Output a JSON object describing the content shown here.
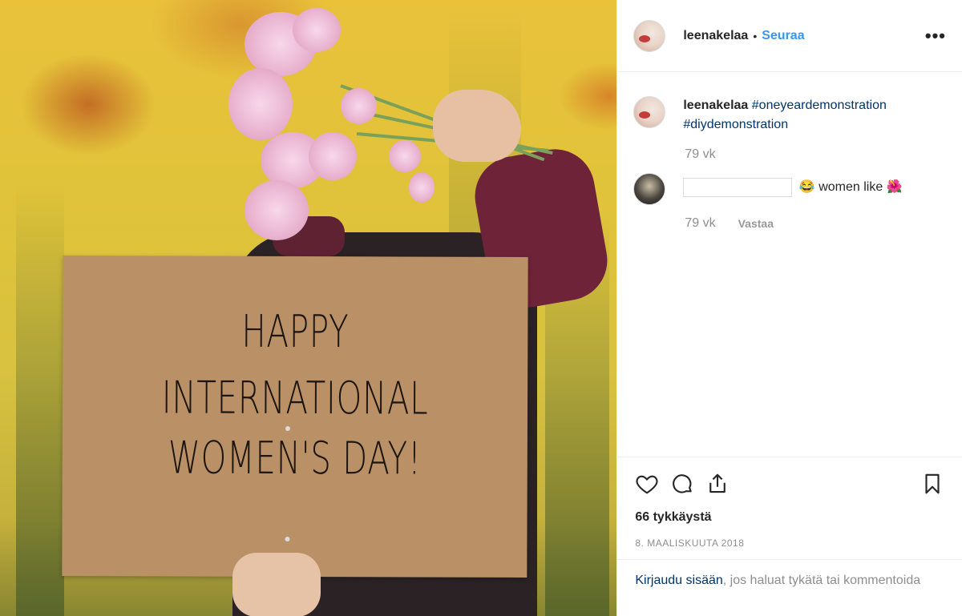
{
  "post": {
    "username": "leenakelaa",
    "separator": "•",
    "follow_label": "Seuraa",
    "more_label": "•••"
  },
  "photo": {
    "sign_lines": [
      "HAPPY",
      "INTERNATIONAL",
      "WOMEN'S DAY!"
    ]
  },
  "caption": {
    "username": "leenakelaa",
    "hashtag1": "#oneyeardemonstration",
    "hashtag2": "#diydemonstration",
    "time": "79 vk"
  },
  "comment": {
    "emoji1": "😂",
    "text": "women like",
    "emoji2": "🌺",
    "time": "79 vk",
    "reply_label": "Vastaa"
  },
  "actions": {
    "likes": "66 tykkäystä",
    "date": "8. MAALISKUUTA 2018"
  },
  "login": {
    "link": "Kirjaudu sisään",
    "text": ", jos haluat tykätä tai kommentoida"
  },
  "icons": [
    "heart-icon",
    "comment-icon",
    "share-icon",
    "bookmark-icon",
    "more-icon"
  ]
}
